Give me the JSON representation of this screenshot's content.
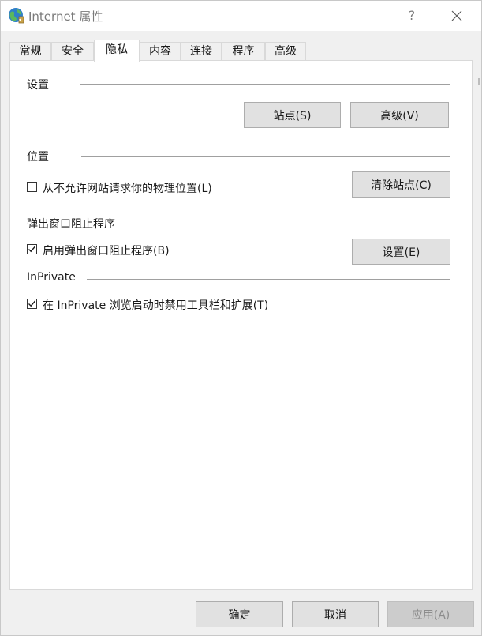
{
  "window": {
    "title": "Internet 属性",
    "help": "?",
    "close": "✕"
  },
  "tabs": [
    {
      "label": "常规"
    },
    {
      "label": "安全"
    },
    {
      "label": "隐私"
    },
    {
      "label": "内容"
    },
    {
      "label": "连接"
    },
    {
      "label": "程序"
    },
    {
      "label": "高级"
    }
  ],
  "active_tab": "隐私",
  "settings": {
    "label": "设置",
    "sites_button": "站点(S)",
    "advanced_button": "高级(V)"
  },
  "location": {
    "label": "位置",
    "checkbox_label": "从不允许网站请求你的物理位置(L)",
    "checked": false,
    "clear_button": "清除站点(C)"
  },
  "popup": {
    "label": "弹出窗口阻止程序",
    "checkbox_label": "启用弹出窗口阻止程序(B)",
    "checked": true,
    "settings_button": "设置(E)"
  },
  "inprivate": {
    "label": "InPrivate",
    "checkbox_label": "在 InPrivate 浏览启动时禁用工具栏和扩展(T)",
    "checked": true
  },
  "footer": {
    "ok": "确定",
    "cancel": "取消",
    "apply": "应用(A)"
  },
  "colors": {
    "accent": "#0078d7",
    "button_face": "#e1e1e1",
    "border": "#adadad"
  }
}
